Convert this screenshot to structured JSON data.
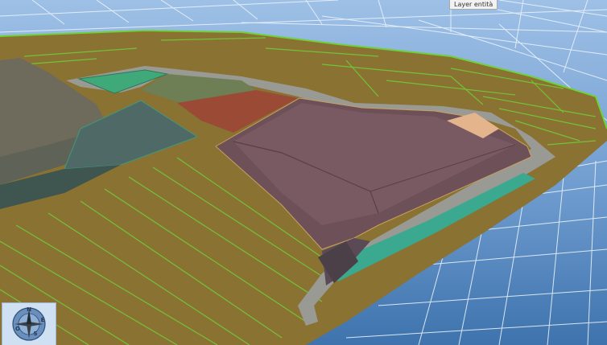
{
  "tooltip": {
    "text": "Layer entità"
  },
  "compass": {
    "north": "N",
    "east": "E",
    "south": "S",
    "west": "O"
  },
  "colors": {
    "sky_top": "#3e73ad",
    "sky_bottom": "#9ec0e6",
    "grid": "#eaf2fb",
    "field": "#8a7232",
    "field_line": "#6fd03a",
    "road": "#9a9a94",
    "landfill": "#6e5158",
    "landfill_top": "#7a5a62",
    "red_plot": "#9a4a35",
    "green_plot": "#3fa97a",
    "olive_plot": "#6f7f55",
    "slate_plot": "#4f6a66",
    "gray_hill": "#6e6a5c",
    "sand": "#e4b48c",
    "teal_strip": "#3aa98f"
  }
}
